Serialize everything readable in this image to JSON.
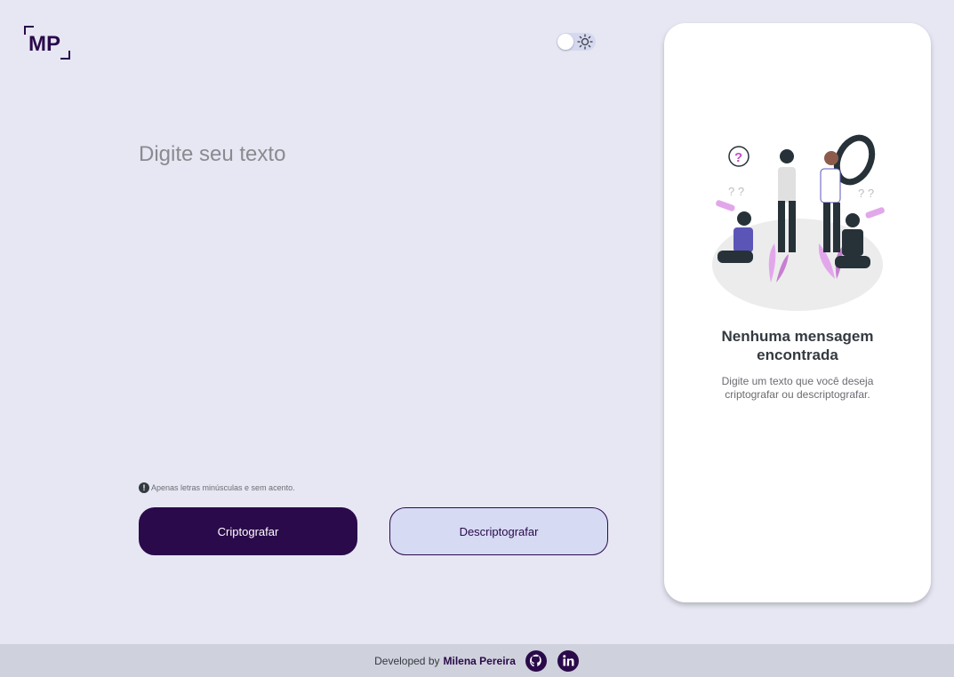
{
  "logo": {
    "text": "MP"
  },
  "theme_toggle": {
    "icon": "sun-icon"
  },
  "input": {
    "placeholder": "Digite seu texto",
    "value": ""
  },
  "hint": {
    "icon": "info-icon",
    "text": "Apenas letras minúsculas e sem acento."
  },
  "buttons": {
    "encrypt_label": "Criptografar",
    "decrypt_label": "Descriptografar"
  },
  "output": {
    "title": "Nenhuma mensagem encontrada",
    "description": "Digite um texto que você deseja criptografar ou descriptografar.",
    "illustration": "people-searching-illustration"
  },
  "footer": {
    "prefix": "Developed by",
    "name": "Milena Pereira",
    "links": [
      "github-icon",
      "linkedin-icon"
    ]
  },
  "colors": {
    "background": "#e6e7f3",
    "primary": "#2a0a4a",
    "secondary_bg": "#d6daf3",
    "footer_bg": "#cfd1dc"
  }
}
